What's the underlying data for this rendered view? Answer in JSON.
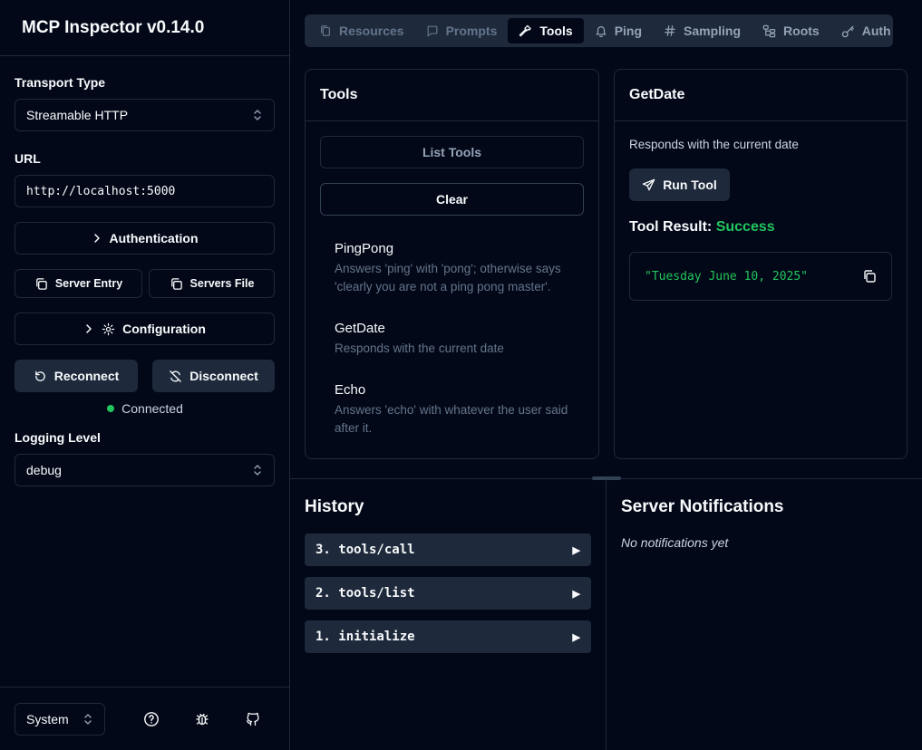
{
  "app": {
    "title": "MCP Inspector v0.14.0"
  },
  "sidebar": {
    "transport_label": "Transport Type",
    "transport_value": "Streamable HTTP",
    "url_label": "URL",
    "url_value": "http://localhost:5000",
    "authentication_label": "Authentication",
    "server_entry_label": "Server Entry",
    "servers_file_label": "Servers File",
    "configuration_label": "Configuration",
    "reconnect_label": "Reconnect",
    "disconnect_label": "Disconnect",
    "status_text": "Connected",
    "status_color": "#22c55e",
    "logging_label": "Logging Level",
    "logging_value": "debug",
    "theme_value": "System"
  },
  "tabs": [
    {
      "label": "Resources",
      "icon": "files-icon"
    },
    {
      "label": "Prompts",
      "icon": "message-square-icon"
    },
    {
      "label": "Tools",
      "icon": "hammer-icon",
      "active": true
    },
    {
      "label": "Ping",
      "icon": "bell-icon"
    },
    {
      "label": "Sampling",
      "icon": "hash-icon"
    },
    {
      "label": "Roots",
      "icon": "folder-tree-icon"
    },
    {
      "label": "Auth",
      "icon": "key-icon"
    }
  ],
  "tools_panel": {
    "title": "Tools",
    "list_tools_label": "List Tools",
    "clear_label": "Clear",
    "items": [
      {
        "name": "PingPong",
        "description": "Answers 'ping' with 'pong'; otherwise says 'clearly you are not a ping pong master'."
      },
      {
        "name": "GetDate",
        "description": "Responds with the current date"
      },
      {
        "name": "Echo",
        "description": "Answers 'echo' with whatever the user said after it."
      }
    ]
  },
  "detail_panel": {
    "title": "GetDate",
    "description": "Responds with the current date",
    "run_label": "Run Tool",
    "result_label": "Tool Result:",
    "result_status": "Success",
    "result_color": "#22c55e",
    "result_value": "\"Tuesday June 10, 2025\""
  },
  "history": {
    "title": "History",
    "items": [
      {
        "label": "3. tools/call"
      },
      {
        "label": "2. tools/list"
      },
      {
        "label": "1. initialize"
      }
    ]
  },
  "notifications": {
    "title": "Server Notifications",
    "empty_text": "No notifications yet"
  }
}
